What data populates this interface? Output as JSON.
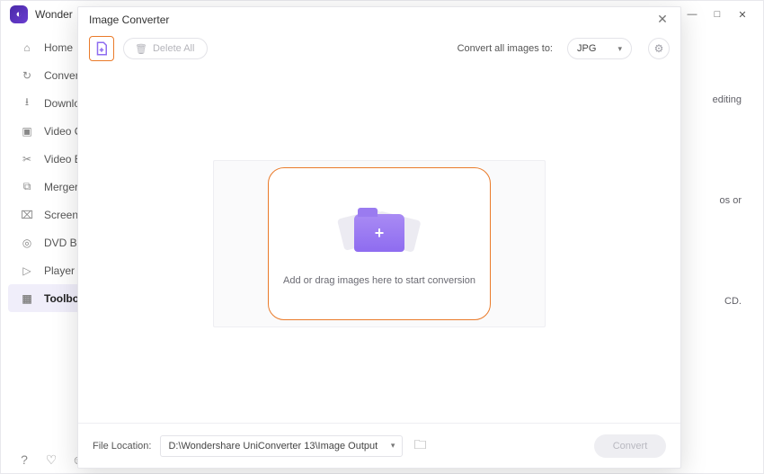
{
  "app_name": "Wonder",
  "window": {
    "min": "min",
    "max": "max",
    "close": "close"
  },
  "sidebar": {
    "items": [
      {
        "label": "Home",
        "icon": "home-icon"
      },
      {
        "label": "Convert",
        "icon": "converter-icon"
      },
      {
        "label": "Downlo",
        "icon": "download-icon"
      },
      {
        "label": "Video C",
        "icon": "video-compress-icon"
      },
      {
        "label": "Video E",
        "icon": "video-edit-icon"
      },
      {
        "label": "Merger",
        "icon": "merger-icon"
      },
      {
        "label": "Screen R",
        "icon": "screen-recorder-icon"
      },
      {
        "label": "DVD Bu",
        "icon": "dvd-burner-icon"
      },
      {
        "label": "Player",
        "icon": "player-icon"
      },
      {
        "label": "Toolbox",
        "icon": "toolbox-icon"
      }
    ]
  },
  "bg_snips": [
    "editing",
    "os or",
    "CD."
  ],
  "modal": {
    "title": "Image Converter",
    "toolbar": {
      "delete_all": "Delete All",
      "convert_all_label": "Convert all images to:",
      "format_selected": "JPG"
    },
    "dropzone": {
      "text": "Add or drag images here to start conversion"
    },
    "footer": {
      "location_label": "File Location:",
      "location_path": "D:\\Wondershare UniConverter 13\\Image Output",
      "convert_label": "Convert"
    }
  }
}
